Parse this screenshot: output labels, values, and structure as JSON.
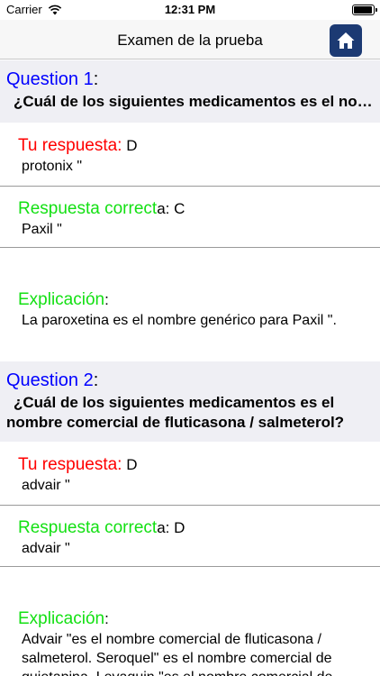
{
  "status": {
    "carrier": "Carrier",
    "time": "12:31 PM"
  },
  "nav": {
    "title": "Examen de la prueba",
    "home_icon": "home-icon"
  },
  "questions": [
    {
      "title": "Question 1",
      "colon": ":",
      "text": "¿Cuál de los siguientes medicamentos es el nombre comercial de paroxetina?",
      "your_label": "Tu respuesta:",
      "your_letter": " D",
      "your_answer": "protonix \"",
      "correct_label": "Respuesta correct",
      "correct_suffix": "a: C",
      "correct_answer": "Paxil \"",
      "explain_label": "Explicación",
      "explain_suffix": ":",
      "explain_text": "La paroxetina es el nombre genérico para Paxil \"."
    },
    {
      "title": "Question 2",
      "colon": ":",
      "text": "¿Cuál de los siguientes medicamentos es el nombre comercial de fluticasona / salmeterol?",
      "your_label": "Tu respuesta:",
      "your_letter": " D",
      "your_answer": "advair \"",
      "correct_label": "Respuesta correct",
      "correct_suffix": "a: D",
      "correct_answer": "advair \"",
      "explain_label": "Explicación",
      "explain_suffix": ":",
      "explain_text": "Advair \"es el nombre comercial de fluticasona / salmeterol. Seroquel\" es el nombre comercial de quietapina. Levaquin \"es el nombre comercial de levofloxacina."
    }
  ],
  "colors": {
    "question_title": "#0000ff",
    "your_answer_label": "#ff0000",
    "correct_label": "#13e013",
    "home_button": "#1c3a73"
  }
}
